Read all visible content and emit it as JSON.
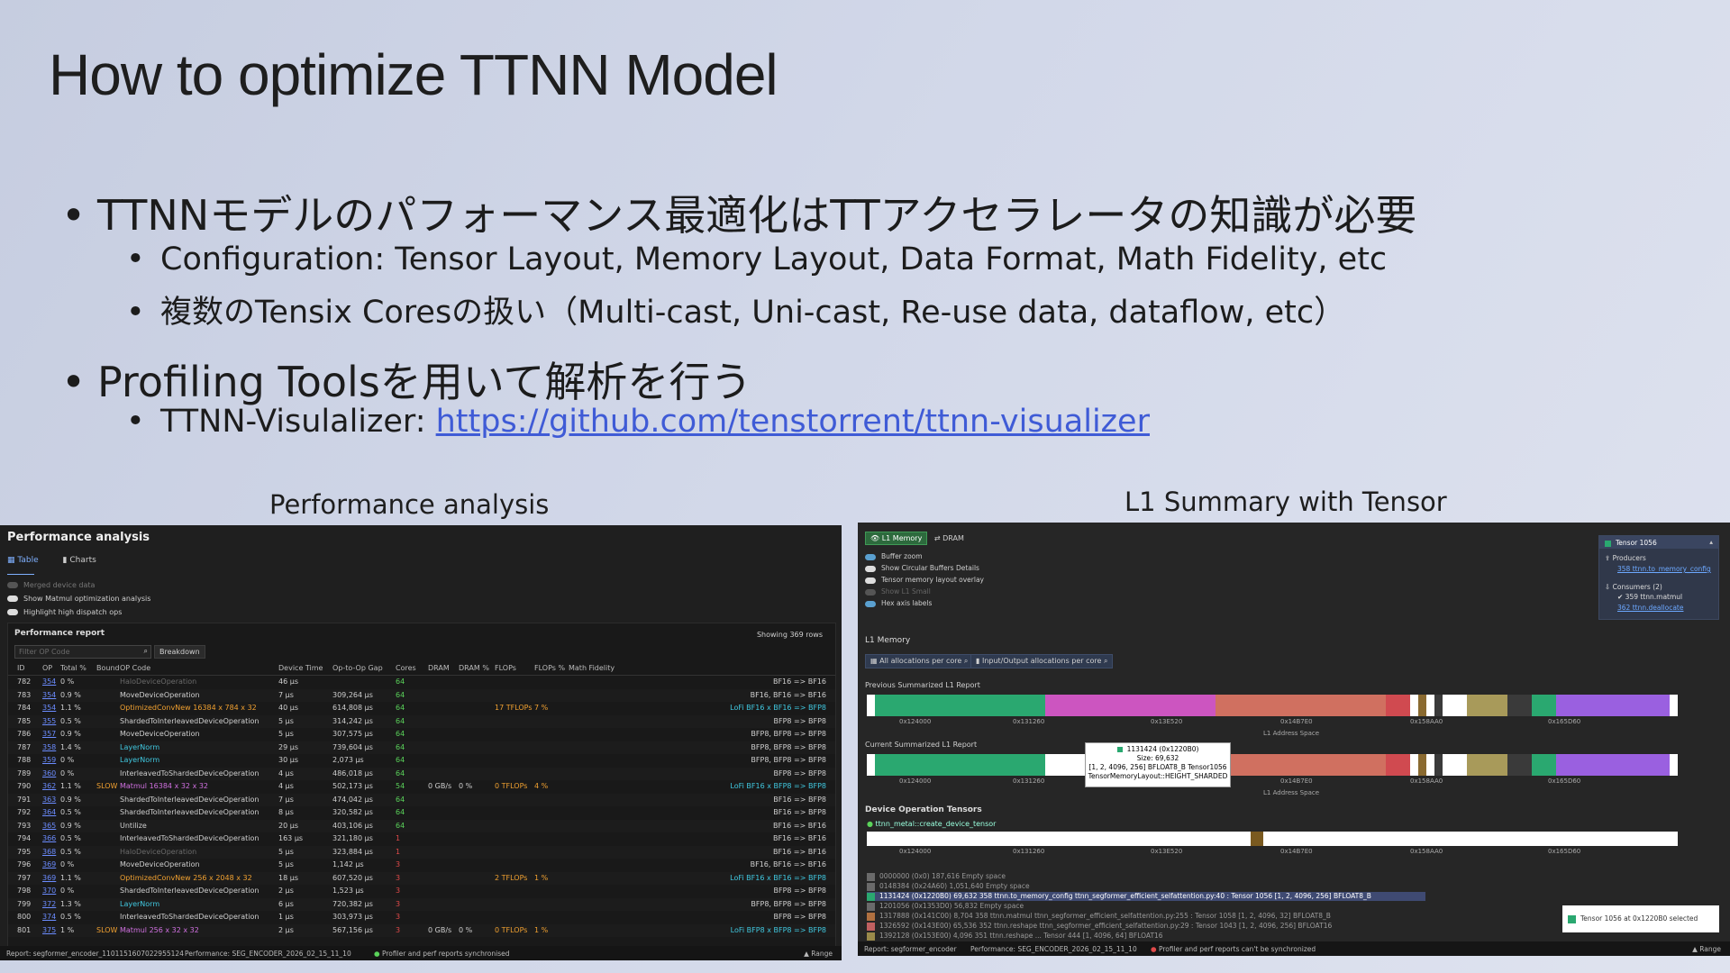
{
  "slide": {
    "title": "How to optimize TTNN Model",
    "bullets": [
      {
        "level": 1,
        "text": "TTNNモデルのパフォーマンス最適化はTTアクセラレータの知識が必要"
      },
      {
        "level": 2,
        "text": "Configuration: Tensor Layout, Memory Layout, Data Format, Math Fidelity, etc"
      },
      {
        "level": 2,
        "text": "複数のTensix Coresの扱い（Multi-cast, Uni-cast, Re-use data, dataflow, etc）"
      },
      {
        "level": 1,
        "text": "Profiling Toolsを用いて解析を行う"
      },
      {
        "level": 2,
        "prefix": "TTNN-Visulalizer: ",
        "link": "https://github.com/tenstorrent/ttnn-visualizer"
      }
    ],
    "caption_left": "Performance analysis",
    "caption_right": "L1 Summary with Tensor"
  },
  "perf": {
    "title": "Performance analysis",
    "tabs": [
      "Table",
      "Charts"
    ],
    "toggles": [
      "Merged device data",
      "Show Matmul optimization analysis",
      "Highlight high dispatch ops"
    ],
    "report_title": "Performance report",
    "filter_placeholder": "Filter OP Code",
    "filter_btn": "Breakdown",
    "showing": "Showing 369 rows",
    "columns": [
      "ID",
      "OP",
      "Total %",
      "Bound",
      "OP Code",
      "Device Time",
      "Op-to-Op Gap",
      "Cores",
      "DRAM",
      "DRAM %",
      "FLOPs",
      "FLOPs %",
      "Math Fidelity"
    ],
    "rows": [
      [
        "782",
        "354",
        "0 %",
        "",
        "HaloDeviceOperation",
        "46 µs",
        "",
        "64",
        "",
        "",
        "",
        "",
        "BF16 => BF16"
      ],
      [
        "783",
        "354",
        "0.9 %",
        "",
        "MoveDeviceOperation",
        "7 µs",
        "309,264 µs",
        "64",
        "",
        "",
        "",
        "",
        "BF16, BF16 => BF16"
      ],
      [
        "784",
        "354",
        "1.1 %",
        "",
        "OptimizedConvNew 16384 x 784 x 32",
        "40 µs",
        "614,808 µs",
        "64",
        "",
        "",
        "17 TFLOPs",
        "7 %",
        "LoFi BF16 x BF16 => BFP8"
      ],
      [
        "785",
        "355",
        "0.5 %",
        "",
        "ShardedToInterleavedDeviceOperation",
        "5 µs",
        "314,242 µs",
        "64",
        "",
        "",
        "",
        "",
        "BFP8 => BFP8"
      ],
      [
        "786",
        "357",
        "0.9 %",
        "",
        "MoveDeviceOperation",
        "5 µs",
        "307,575 µs",
        "64",
        "",
        "",
        "",
        "",
        "BFP8, BFP8 => BFP8"
      ],
      [
        "787",
        "358",
        "1.4 %",
        "",
        "LayerNorm",
        "29 µs",
        "739,604 µs",
        "64",
        "",
        "",
        "",
        "",
        "BFP8, BFP8 => BFP8"
      ],
      [
        "788",
        "359",
        "0 %",
        "",
        "LayerNorm",
        "30 µs",
        "2,073 µs",
        "64",
        "",
        "",
        "",
        "",
        "BFP8, BFP8 => BFP8"
      ],
      [
        "789",
        "360",
        "0 %",
        "",
        "InterleavedToShardedDeviceOperation",
        "4 µs",
        "486,018 µs",
        "64",
        "",
        "",
        "",
        "",
        "BFP8 => BFP8"
      ],
      [
        "790",
        "362",
        "1.1 %",
        "SLOW",
        "Matmul 16384 x 32 x 32",
        "4 µs",
        "502,173 µs",
        "54",
        "0 GB/s",
        "0 %",
        "0 TFLOPs",
        "4 %",
        "LoFi BF16 x BFP8 => BFP8"
      ],
      [
        "791",
        "363",
        "0.9 %",
        "",
        "ShardedToInterleavedDeviceOperation",
        "7 µs",
        "474,042 µs",
        "64",
        "",
        "",
        "",
        "",
        "BF16 => BFP8"
      ],
      [
        "792",
        "364",
        "0.5 %",
        "",
        "ShardedToInterleavedDeviceOperation",
        "8 µs",
        "320,582 µs",
        "64",
        "",
        "",
        "",
        "",
        "BF16 => BFP8"
      ],
      [
        "793",
        "365",
        "0.9 %",
        "",
        "Untilize",
        "20 µs",
        "403,106 µs",
        "64",
        "",
        "",
        "",
        "",
        "BF16 => BF16"
      ],
      [
        "794",
        "366",
        "0.5 %",
        "",
        "InterleavedToShardedDeviceOperation",
        "163 µs",
        "321,180 µs",
        "1",
        "",
        "",
        "",
        "",
        "BF16 => BF16"
      ],
      [
        "795",
        "368",
        "0.5 %",
        "",
        "HaloDeviceOperation",
        "5 µs",
        "323,884 µs",
        "1",
        "",
        "",
        "",
        "",
        "BF16 => BF16"
      ],
      [
        "796",
        "369",
        "0 %",
        "",
        "MoveDeviceOperation",
        "5 µs",
        "1,142 µs",
        "3",
        "",
        "",
        "",
        "",
        "BF16, BF16 => BF16"
      ],
      [
        "797",
        "369",
        "1.1 %",
        "",
        "OptimizedConvNew 256 x 2048 x 32",
        "18 µs",
        "607,520 µs",
        "3",
        "",
        "",
        "2 TFLOPs",
        "1 %",
        "LoFi BF16 x BF16 => BFP8"
      ],
      [
        "798",
        "370",
        "0 %",
        "",
        "ShardedToInterleavedDeviceOperation",
        "2 µs",
        "1,523 µs",
        "3",
        "",
        "",
        "",
        "",
        "BFP8 => BFP8"
      ],
      [
        "799",
        "372",
        "1.3 %",
        "",
        "LayerNorm",
        "6 µs",
        "720,382 µs",
        "3",
        "",
        "",
        "",
        "",
        "BFP8, BFP8 => BFP8"
      ],
      [
        "800",
        "374",
        "0.5 %",
        "",
        "InterleavedToShardedDeviceOperation",
        "1 µs",
        "303,973 µs",
        "3",
        "",
        "",
        "",
        "",
        "BFP8 => BFP8"
      ],
      [
        "801",
        "375",
        "1 %",
        "SLOW",
        "Matmul 256 x 32 x 32",
        "2 µs",
        "567,156 µs",
        "3",
        "0 GB/s",
        "0 %",
        "0 TFLOPs",
        "1 %",
        "LoFi BFP8 x BFP8 => BFP8"
      ]
    ],
    "status": {
      "report": "Report: segformer_encoder_1101151607022955124",
      "perf": "Performance: SEG_ENCODER_2026_02_15_11_10",
      "sync": "Profiler and perf reports synchronised",
      "range": "Range"
    }
  },
  "l1": {
    "tabs": [
      "L1 Memory",
      "DRAM"
    ],
    "toggles": [
      "Buffer zoom",
      "Show Circular Buffers Details",
      "Tensor memory layout overlay",
      "Show L1 Small",
      "Hex axis labels"
    ],
    "section": "L1 Memory",
    "btn_all": "All allocations per core",
    "btn_io": "Input/Output allocations per core",
    "prev_label": "Previous Summarized L1 Report",
    "curr_label": "Current Summarized L1 Report",
    "axis_ticks": [
      "0x124000",
      "0x131260",
      "0x13E520",
      "0x14B7E0",
      "0x158AA0",
      "0x165D60"
    ],
    "axis_title": "L1 Address Space",
    "tooltip": [
      "1131424 (0x1220B0)",
      "Size: 69,632",
      "[1, 2, 4096, 256] BFLOAT8_B Tensor1056",
      "TensorMemoryLayout::HEIGHT_SHARDED"
    ],
    "device_tensors": "Device Operation Tensors",
    "dev_sub": "ttnn_metal::create_device_tensor",
    "sidebar": {
      "title": "Tensor 1056",
      "producers": "Producers",
      "prod_link": "358 ttnn.to_memory_config",
      "consumers": "Consumers (2)",
      "cons1": "359 ttnn.matmul",
      "cons2": "362 ttnn.deallocate"
    },
    "list": [
      {
        "color": "#6a6a6a",
        "text": "0000000 (0x0)  187,616  Empty space"
      },
      {
        "color": "#6a6a6a",
        "text": "0148384 (0x24A60)  1,051,640  Empty space"
      },
      {
        "color": "#2aa870",
        "text": "1131424 (0x1220B0)  69,632  358 ttnn.to_memory_config ttnn_segformer_efficient_selfattention.py:40 : Tensor 1056   [1, 2, 4096, 256] BFLOAT8_B"
      },
      {
        "color": "#6a6a6a",
        "text": "1201056 (0x1353D0)  56,832  Empty space"
      },
      {
        "color": "#b07040",
        "text": "1317888 (0x141C00)  8,704  358 ttnn.matmul ttnn_segformer_efficient_selfattention.py:255 : Tensor 1058   [1, 2, 4096, 32] BFLOAT8_B"
      },
      {
        "color": "#c06060",
        "text": "1326592 (0x143E00)  65,536  352 ttnn.reshape ttnn_segformer_efficient_selfattention.py:29 : Tensor 1043   [1, 2, 4096, 256] BFLOAT16"
      },
      {
        "color": "#9a8a4a",
        "text": "1392128 (0x153E00)  4,096  351 ttnn.reshape ... Tensor 444   [1, 4096, 64] BFLOAT16"
      }
    ],
    "selected": "Tensor 1056 at 0x1220B0 selected",
    "status": {
      "report": "Report: segformer_encoder",
      "perf": "Performance: SEG_ENCODER_2026_02_15_11_10",
      "warn": "Profiler and perf reports can't be synchronized",
      "range": "Range"
    }
  }
}
